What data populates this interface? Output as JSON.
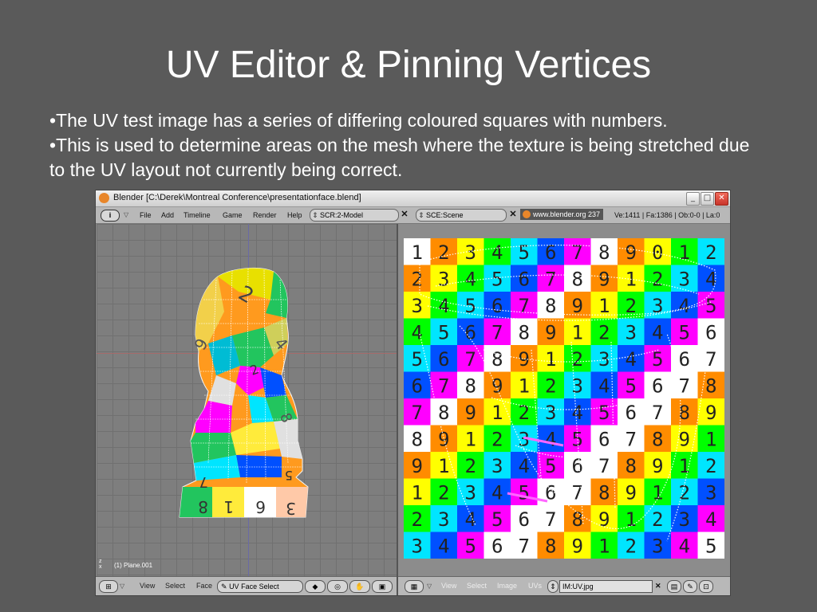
{
  "slide": {
    "title": "UV Editor & Pinning Vertices",
    "bullets": [
      "•The UV test image has a series of differing coloured squares with numbers.",
      "•This is used to determine areas on the mesh where the texture is being stretched due to the UV layout not currently being correct."
    ]
  },
  "window": {
    "title": "Blender [C:\\Derek\\Montreal Conference\\presentationface.blend]",
    "minimize": "_",
    "maximize": "□",
    "close": "✕"
  },
  "topbar": {
    "info_icon": "i",
    "menus": [
      "File",
      "Add",
      "Timeline",
      "Game",
      "Render",
      "Help"
    ],
    "screen": "SCR:2-Model",
    "scene": "SCE:Scene",
    "url": "www.blender.org 237",
    "stats": "Ve:1411 | Fa:1386 | Ob:0-0 | La:0"
  },
  "viewport3d": {
    "object_label": "(1) Plane.001",
    "axis_z": "z",
    "axis_x": "x",
    "face_numbers": [
      "2",
      "8",
      "4",
      "9",
      "7",
      "8",
      "1",
      "6",
      "5",
      "3",
      "2"
    ]
  },
  "uv_editor": {
    "grid": [
      [
        "1",
        "2",
        "3",
        "4",
        "5",
        "6",
        "7",
        "8",
        "9",
        "0",
        "1",
        "2"
      ],
      [
        "2",
        "3",
        "4",
        "5",
        "6",
        "7",
        "8",
        "9",
        "1",
        "2",
        "3",
        "4"
      ],
      [
        "3",
        "4",
        "5",
        "6",
        "7",
        "8",
        "9",
        "1",
        "2",
        "3",
        "4",
        "5"
      ],
      [
        "4",
        "5",
        "6",
        "7",
        "8",
        "9",
        "1",
        "2",
        "3",
        "4",
        "5",
        "6"
      ],
      [
        "5",
        "6",
        "7",
        "8",
        "9",
        "1",
        "2",
        "3",
        "4",
        "5",
        "6",
        "7"
      ],
      [
        "6",
        "7",
        "8",
        "9",
        "1",
        "2",
        "3",
        "4",
        "5",
        "6",
        "7",
        "8"
      ],
      [
        "7",
        "8",
        "9",
        "1",
        "2",
        "3",
        "4",
        "5",
        "6",
        "7",
        "8",
        "9"
      ],
      [
        "8",
        "9",
        "1",
        "2",
        "3",
        "4",
        "5",
        "6",
        "7",
        "8",
        "9",
        "1"
      ],
      [
        "9",
        "1",
        "2",
        "3",
        "4",
        "5",
        "6",
        "7",
        "8",
        "9",
        "1",
        "2"
      ],
      [
        "1",
        "2",
        "3",
        "4",
        "5",
        "6",
        "7",
        "8",
        "9",
        "1",
        "2",
        "3"
      ],
      [
        "2",
        "3",
        "4",
        "5",
        "6",
        "7",
        "8",
        "9",
        "1",
        "2",
        "3",
        "4"
      ],
      [
        "3",
        "4",
        "5",
        "6",
        "7",
        "8",
        "9",
        "1",
        "2",
        "3",
        "4",
        "5"
      ]
    ],
    "palette": [
      "#ffffff",
      "#ff8c00",
      "#ffff00",
      "#00ff00",
      "#00e5ff",
      "#0050ff",
      "#ff00ff",
      "#ffffff",
      "#ff8c00",
      "#ffff00",
      "#00ff00",
      "#00e5ff",
      "#0050ff",
      "#ff00ff",
      "#ffffff"
    ]
  },
  "bottombar_left": {
    "menus": [
      "View",
      "Select",
      "Face"
    ],
    "mode": "UV Face Select"
  },
  "bottombar_right": {
    "menus": [
      "View",
      "Select",
      "Image",
      "UVs"
    ],
    "image": "IM:UV.jpg",
    "clear": "✕"
  }
}
